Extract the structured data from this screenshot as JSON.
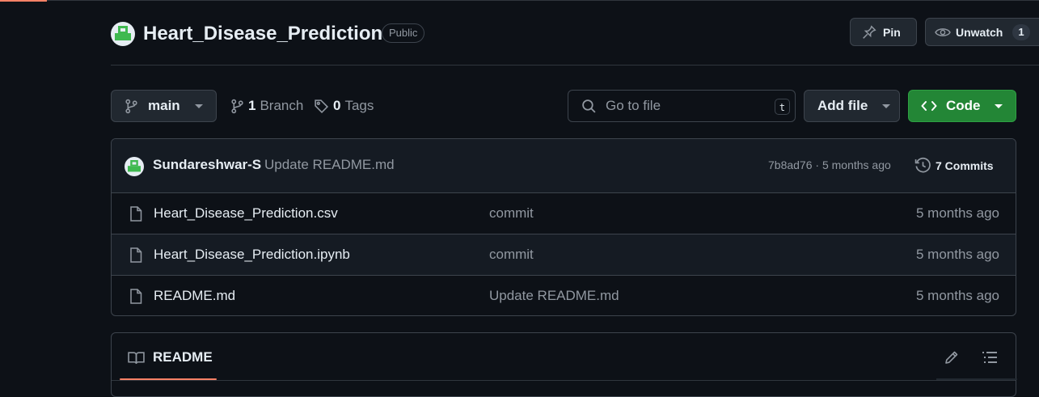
{
  "repo": {
    "name": "Heart_Disease_Prediction",
    "visibility": "Public",
    "avatar_icon": "identicon-avatar"
  },
  "actions": {
    "pin_label": "Pin",
    "unwatch_label": "Unwatch",
    "watch_count": "1"
  },
  "toolbar": {
    "branch": "main",
    "branch_count": "1",
    "branch_label": "Branch",
    "tag_count": "0",
    "tag_label": "Tags",
    "search_placeholder": "Go to file",
    "search_shortcut": "t",
    "add_file_label": "Add file",
    "code_label": "Code"
  },
  "latest_commit": {
    "author": "Sundareshwar-S",
    "message": "Update README.md",
    "meta": "7b8ad76 · 5 months ago",
    "commits_label": "7 Commits"
  },
  "files": [
    {
      "name": "Heart_Disease_Prediction.csv",
      "message": "commit",
      "date": "5 months ago"
    },
    {
      "name": "Heart_Disease_Prediction.ipynb",
      "message": "commit",
      "date": "5 months ago"
    },
    {
      "name": "README.md",
      "message": "Update README.md",
      "date": "5 months ago"
    }
  ],
  "readme": {
    "tab_label": "README"
  },
  "colors": {
    "background": "#0d1117",
    "code_button": "#238636",
    "accent_underline": "#f78166",
    "avatar_green": "#3fb950"
  }
}
